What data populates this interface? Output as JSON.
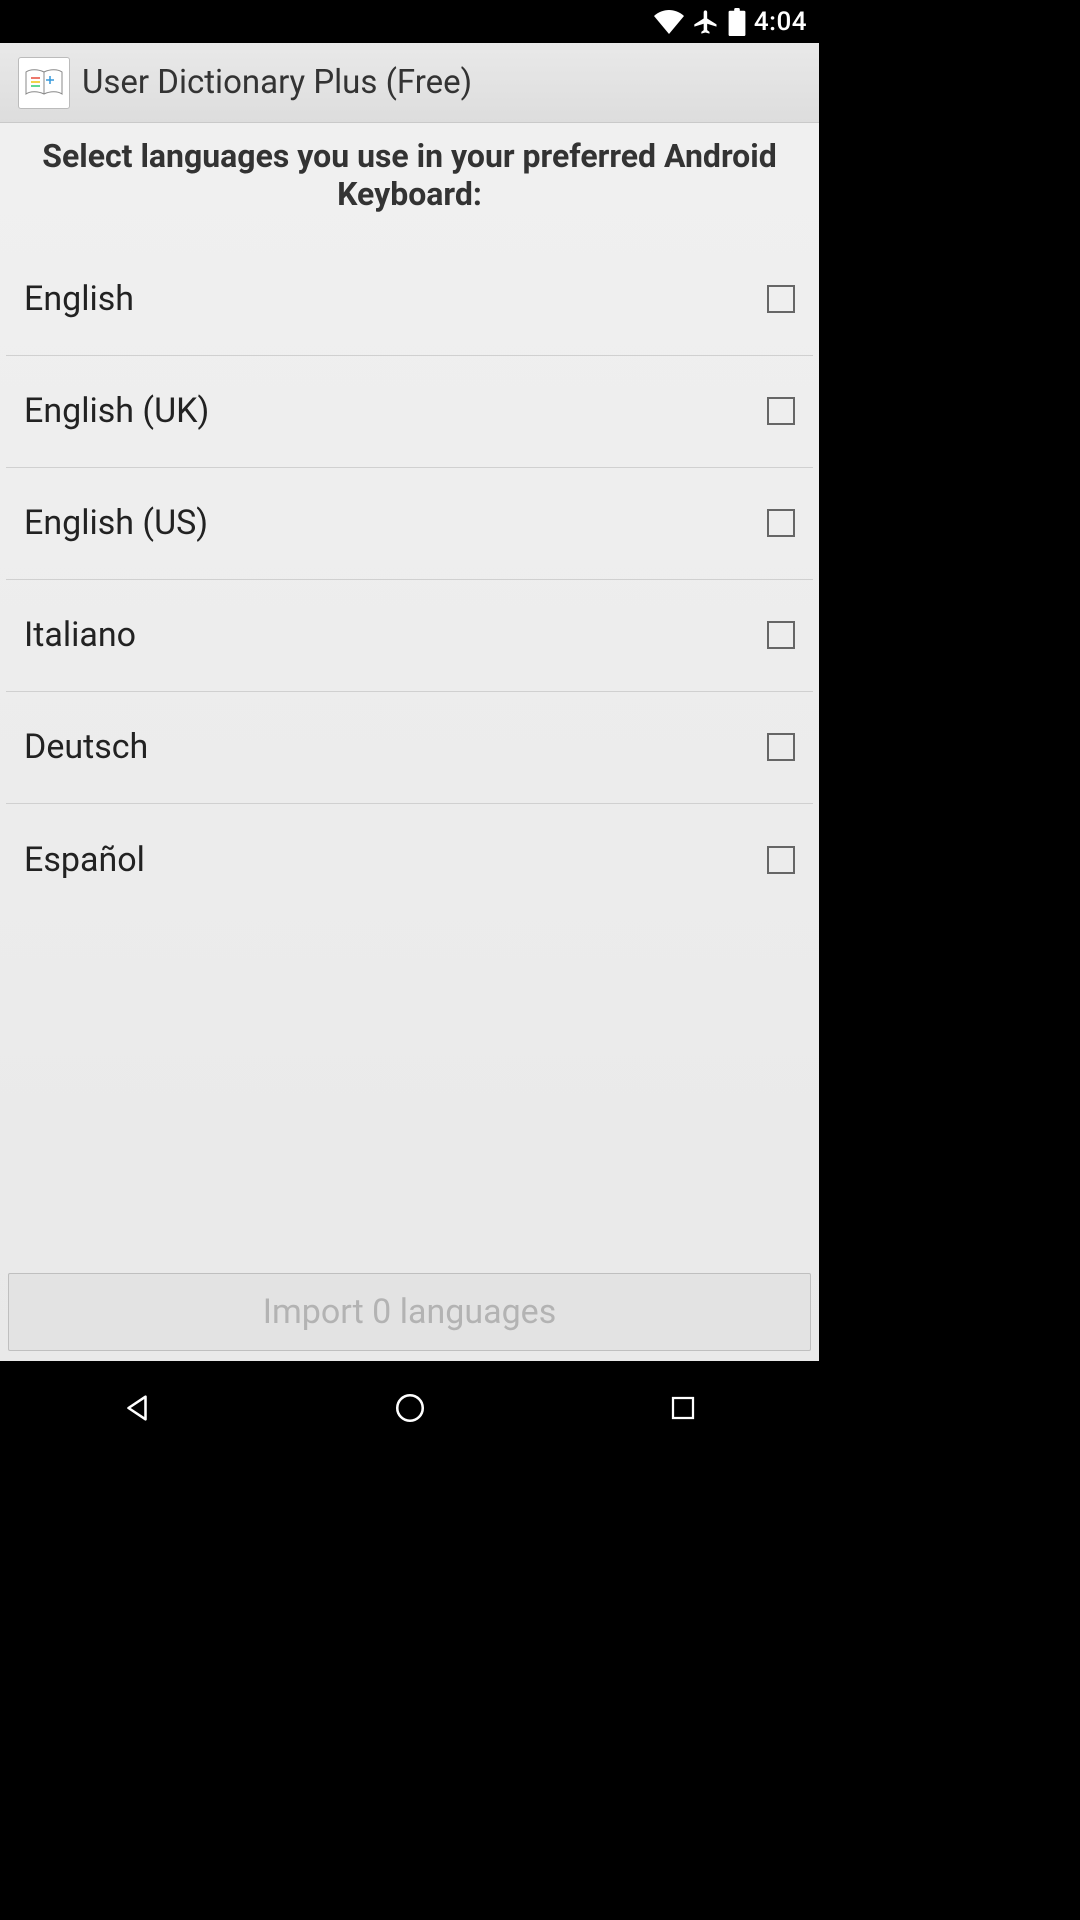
{
  "status": {
    "time": "4:04"
  },
  "titlebar": {
    "app_name": "User Dictionary Plus (Free)"
  },
  "prompt": "Select languages you use in your preferred Android Keyboard:",
  "languages": [
    {
      "label": "English",
      "checked": false
    },
    {
      "label": "English (UK)",
      "checked": false
    },
    {
      "label": "English (US)",
      "checked": false
    },
    {
      "label": "Italiano",
      "checked": false
    },
    {
      "label": "Deutsch",
      "checked": false
    },
    {
      "label": "Español",
      "checked": false
    }
  ],
  "import_button": {
    "label": "Import 0 languages",
    "enabled": false
  }
}
